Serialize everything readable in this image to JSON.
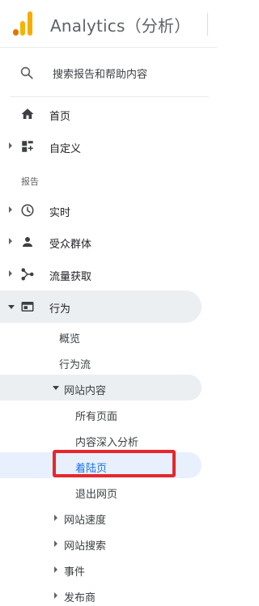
{
  "header": {
    "title": "Analytics（分析）"
  },
  "search": {
    "label": "搜索报告和帮助内容"
  },
  "nav": {
    "home": "首页",
    "customize": "自定义",
    "reports_label": "报告",
    "realtime": "实时",
    "audience": "受众群体",
    "acquisition": "流量获取",
    "behavior": "行为"
  },
  "behavior": {
    "overview": "概览",
    "flow": "行为流",
    "site_content": {
      "label": "网站内容",
      "all_pages": "所有页面",
      "drilldown": "内容深入分析",
      "landing_pages": "着陆页",
      "exit_pages": "退出网页"
    },
    "site_speed": "网站速度",
    "site_search": "网站搜索",
    "events": "事件",
    "publisher": "发布商"
  },
  "colors": {
    "accent": "#1a73e8",
    "highlight": "#e8262b",
    "logo": "#f9ab00"
  }
}
